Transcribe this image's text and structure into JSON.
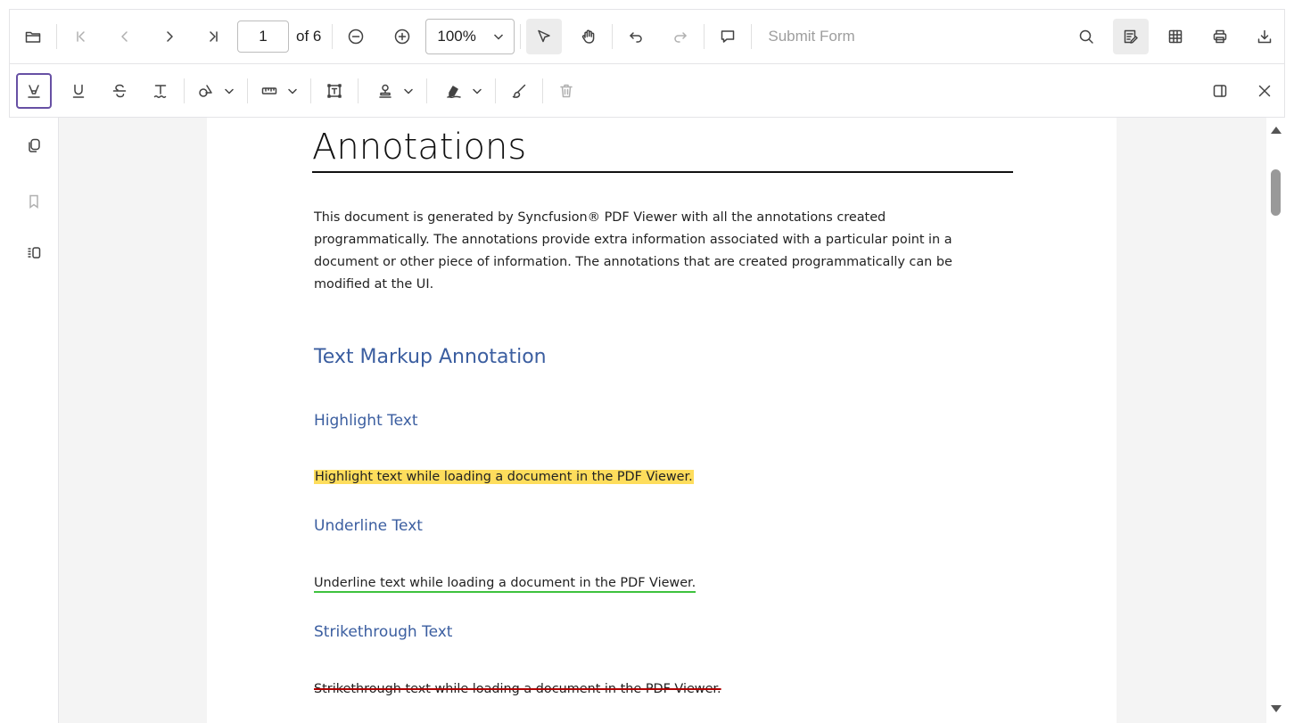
{
  "toolbar": {
    "page_number": "1",
    "page_count": "of 6",
    "zoom": "100%",
    "submit_form": "Submit Form"
  },
  "document": {
    "title": "Annotations",
    "intro": "This document is generated by Syncfusion® PDF Viewer with all the annotations created programmatically. The annotations provide extra information associated with a particular point in a document or other piece of information. The annotations that are created programmatically can be modified at the UI.",
    "section_title": "Text Markup Annotation",
    "highlight_heading": "Highlight Text",
    "highlight_sample": "Highlight text while loading a document in the PDF Viewer.",
    "underline_heading": "Underline Text",
    "underline_sample": "Underline text while loading a document in the PDF Viewer.",
    "strike_heading": "Strikethrough Text",
    "strike_sample": "Strikethrough text while loading a document in the PDF Viewer."
  },
  "colors": {
    "accent": "#6750a4",
    "heading": "#3b5ea0",
    "highlight": "#fedd5c",
    "underline": "#3ec23e",
    "strikethrough": "#b00000"
  }
}
